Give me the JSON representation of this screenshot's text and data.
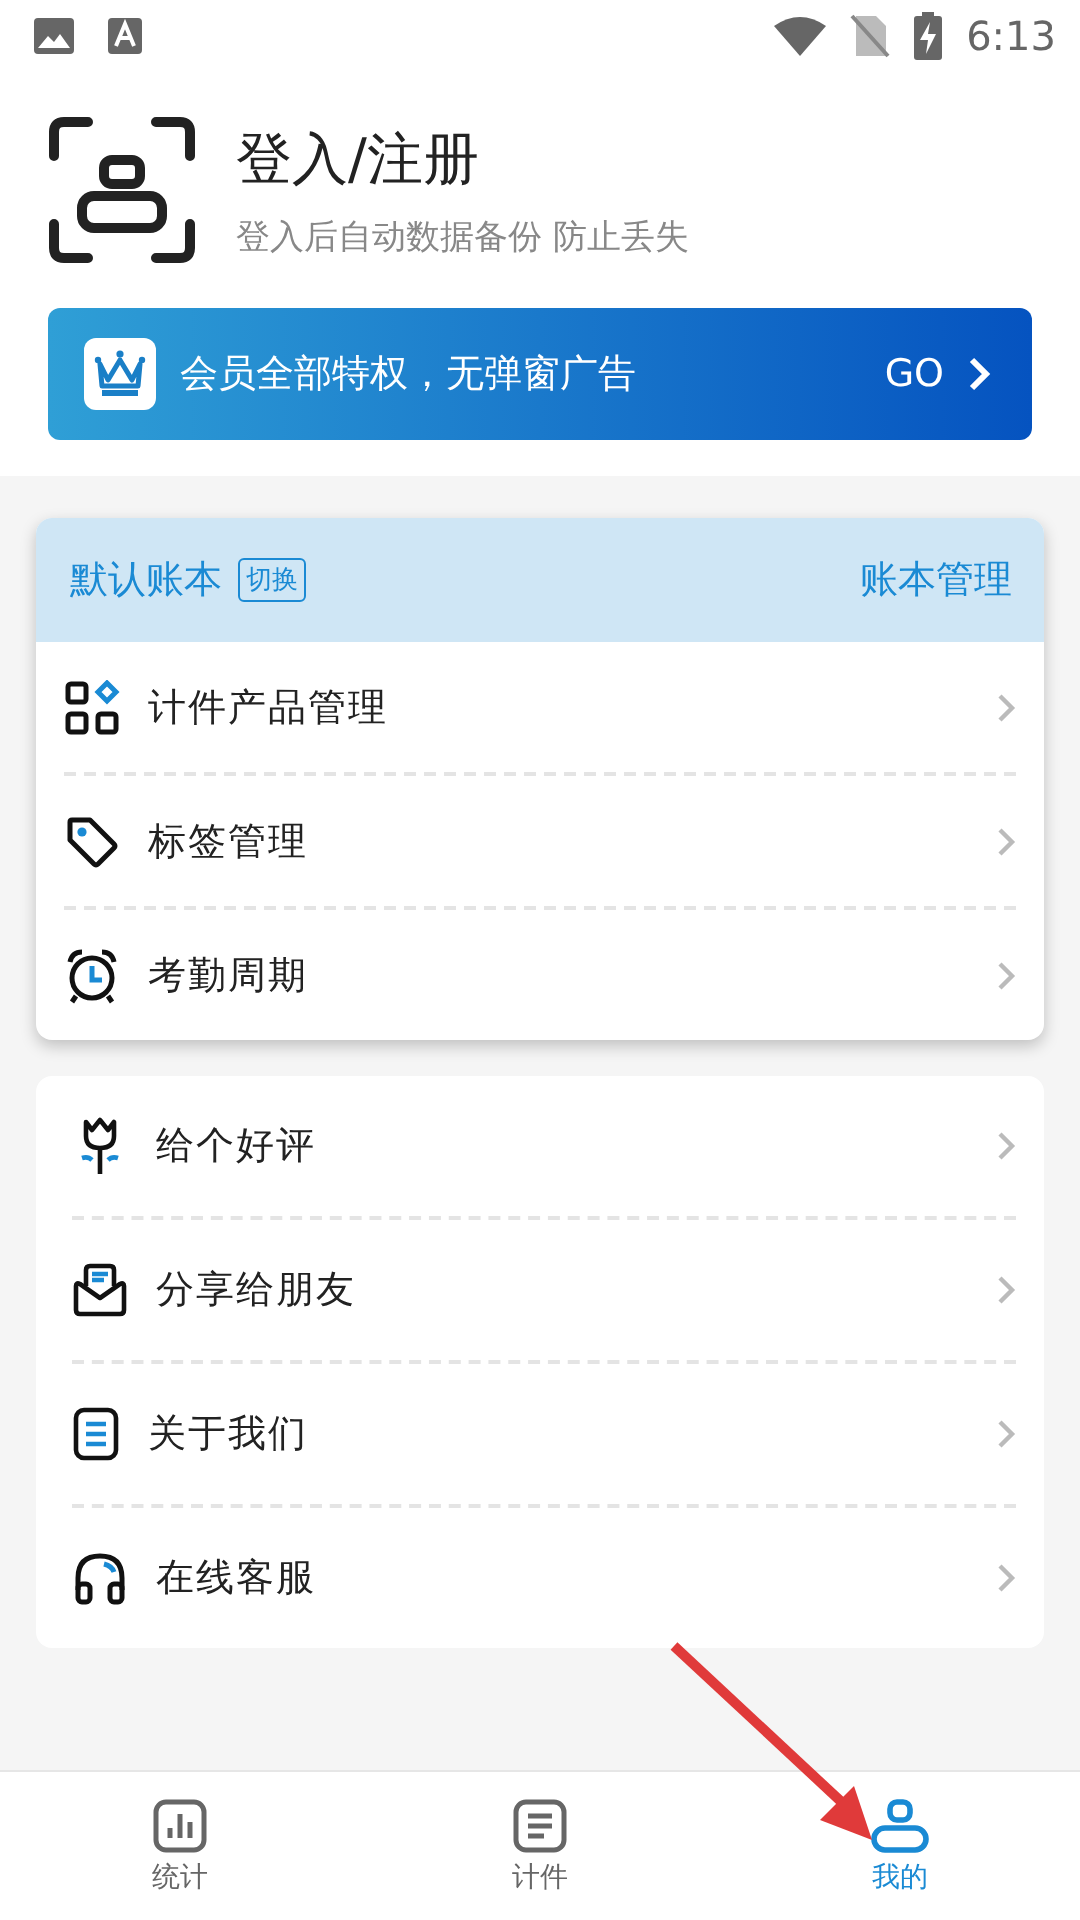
{
  "status_bar": {
    "time": "6:13"
  },
  "login": {
    "title": "登入/注册",
    "subtitle": "登入后自动数据备份 防止丢失"
  },
  "vip_banner": {
    "text": "会员全部特权，无弹窗广告",
    "action": "GO"
  },
  "account_card": {
    "book_name": "默认账本",
    "switch_label": "切换",
    "manage_label": "账本管理",
    "items": [
      {
        "label": "计件产品管理"
      },
      {
        "label": "标签管理"
      },
      {
        "label": "考勤周期"
      }
    ]
  },
  "more_card": {
    "items": [
      {
        "label": "给个好评"
      },
      {
        "label": "分享给朋友"
      },
      {
        "label": "关于我们"
      },
      {
        "label": "在线客服"
      }
    ]
  },
  "tabs": [
    {
      "label": "统计",
      "selected": false
    },
    {
      "label": "计件",
      "selected": false
    },
    {
      "label": "我的",
      "selected": true
    }
  ]
}
